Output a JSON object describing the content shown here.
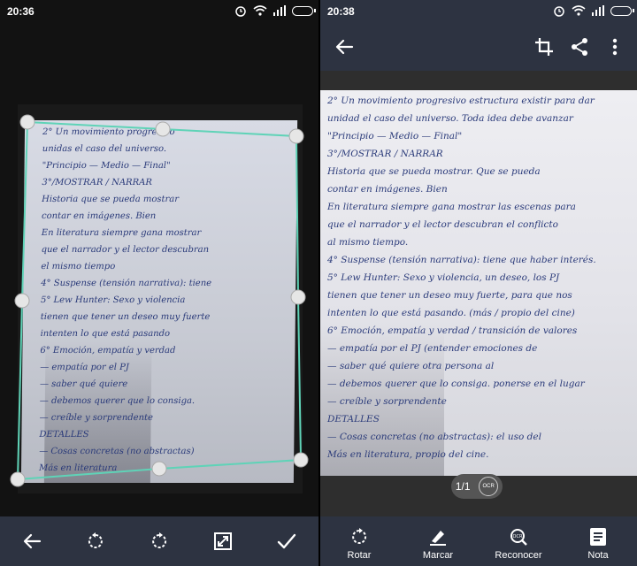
{
  "left": {
    "status": {
      "time": "20:36"
    },
    "handwriting": [
      "2° Un movimiento progresivo",
      "unidas el caso del universo.",
      "\"Principio — Medio — Final\"",
      "3°/MOSTRAR / NARRAR",
      "Historia que se pueda mostrar",
      "contar en imágenes. Bien",
      "En literatura siempre gana mostrar",
      "que el narrador y el lector descubran",
      "el mismo tiempo",
      "4° Suspense (tensión narrativa): tiene",
      "5° Lew Hunter: Sexo y violencia",
      "tienen que tener un deseo muy fuerte",
      "intenten lo que está pasando",
      "6° Emoción, empatía y verdad",
      "— empatía por el PJ",
      "— saber qué quiere",
      "— debemos querer que lo consiga.",
      "— creíble y sorprendente",
      "DETALLES",
      "— Cosas concretas (no abstractas)",
      "Más en literatura"
    ]
  },
  "right": {
    "status": {
      "time": "20:38"
    },
    "page_indicator": {
      "current": "1/1",
      "ocr_label": "OCR"
    },
    "handwriting": [
      "2° Un movimiento progresivo estructura existir para dar",
      "unidad el caso del universo. Toda idea debe avanzar",
      "\"Principio — Medio — Final\"",
      "3°/MOSTRAR / NARRAR",
      "Historia que se pueda mostrar. Que se pueda",
      "contar en imágenes. Bien",
      "En literatura siempre gana mostrar las escenas para",
      "que el narrador y el lector descubran el conflicto",
      "al mismo tiempo.",
      "4° Suspense (tensión narrativa): tiene que haber interés.",
      "5° Lew Hunter: Sexo y violencia, un deseo, los PJ",
      "tienen que tener un deseo muy fuerte, para que nos",
      "intenten lo que está pasando. (más / propio del cine)",
      "6° Emoción, empatía y verdad / transición de valores",
      "— empatía por el PJ (entender emociones de",
      "— saber qué quiere       otra persona al",
      "— debemos querer que lo consiga.   ponerse en el lugar",
      "— creíble y sorprendente",
      "DETALLES",
      "— Cosas concretas (no abstractas): el uso del",
      "Más en literatura, propio del cine."
    ],
    "bottom_nav": [
      {
        "label": "Rotar"
      },
      {
        "label": "Marcar"
      },
      {
        "label": "Reconocer"
      },
      {
        "label": "Nota"
      }
    ]
  },
  "colors": {
    "toolbar": "#2d3341",
    "crop_line": "#5fd3b7",
    "ink": "#2b3b7a"
  },
  "icons": {
    "left_toolbar": [
      "back-arrow-icon",
      "rotate-left-icon",
      "rotate-right-icon",
      "expand-icon",
      "check-icon"
    ],
    "right_actions": [
      "back-arrow-icon",
      "crop-icon",
      "share-icon",
      "more-vert-icon"
    ]
  }
}
